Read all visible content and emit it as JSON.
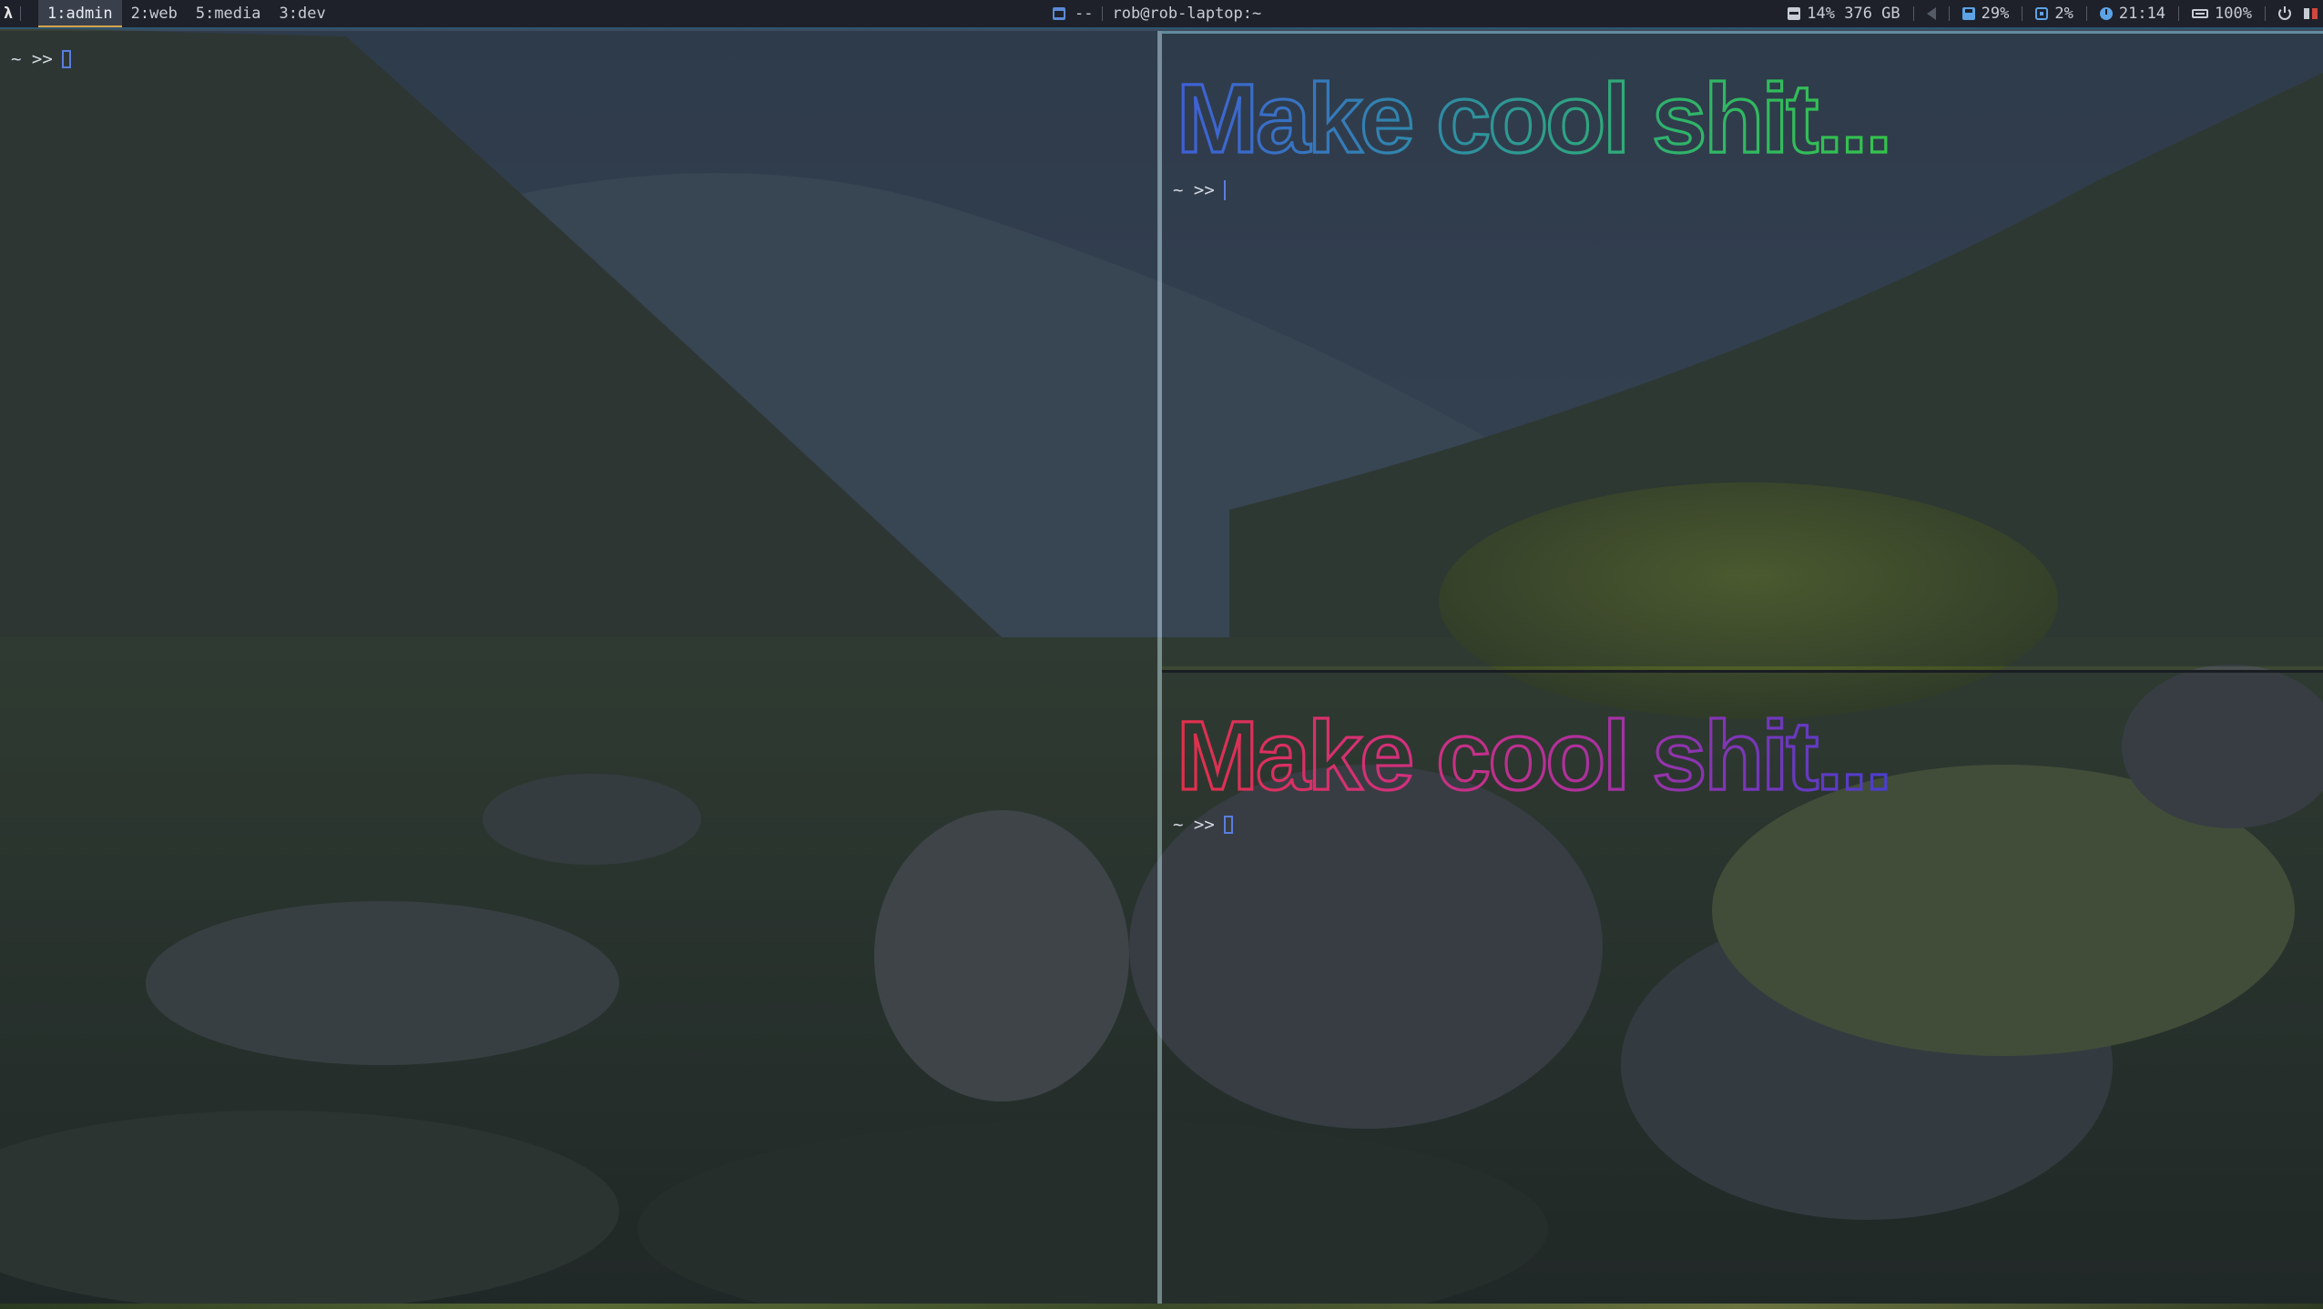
{
  "colors": {
    "accent_blue": "#5a7de0",
    "bar_bg": "#1e2129",
    "active_underline": "#d5a34a",
    "banner_top_gradient": [
      "#3f5fd8",
      "#2e8aa8",
      "#2fb46a",
      "#34c44a"
    ],
    "banner_bottom_gradient": [
      "#e0304a",
      "#d4307a",
      "#b2309a",
      "#7a36b8",
      "#4a3ed0"
    ]
  },
  "bar": {
    "launcher_glyph": "λ",
    "workspaces": [
      "1:admin",
      "2:web",
      "5:media",
      "3:dev"
    ],
    "active_workspace": "1:admin",
    "window_mode": "--",
    "window_title": "rob@rob-laptop:~",
    "disk": "14% 376 GB",
    "memory": "29%",
    "cpu": "2%",
    "clock": "21:14",
    "battery": "100%",
    "icons": {
      "window": "window-icon",
      "disk": "disk-icon",
      "volume": "volume-muted-icon",
      "memory": "memory-icon",
      "cpu": "cpu-icon",
      "clock": "clock-icon",
      "battery": "battery-icon",
      "power": "power-icon"
    }
  },
  "terminals": {
    "left": {
      "prompt": "~ >>"
    },
    "top_right": {
      "banner": "Make cool shit...",
      "prompt": "~ >>"
    },
    "bottom_right": {
      "banner": "Make cool shit...",
      "prompt": "~ >>"
    }
  }
}
